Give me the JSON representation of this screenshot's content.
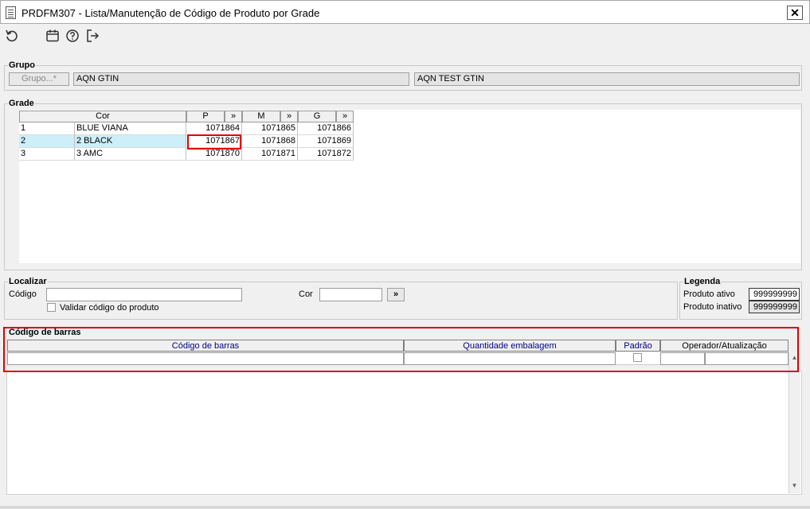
{
  "window": {
    "title": "PRDFM307 - Lista/Manutenção de Código de Produto por Grade",
    "close_label": "✕"
  },
  "toolbar": {
    "icons": [
      "refresh-icon",
      "calendar-icon",
      "help-icon",
      "exit-icon"
    ]
  },
  "grupo": {
    "title": "Grupo",
    "button_label": "Grupo...*",
    "code_value": "AQN GTIN",
    "desc_value": "AQN TEST GTIN"
  },
  "grade": {
    "title": "Grade",
    "headers": {
      "cor": "Cor",
      "p": "P",
      "m": "M",
      "g": "G",
      "more": "»"
    },
    "rows": [
      {
        "num": "1",
        "cor": "BLUE VIANA",
        "p": "1071864",
        "m": "1071865",
        "g": "1071866"
      },
      {
        "num": "2",
        "cor": "2 BLACK",
        "p": "1071867",
        "m": "1071868",
        "g": "1071869"
      },
      {
        "num": "3",
        "cor": "3 AMC",
        "p": "1071870",
        "m": "1071871",
        "g": "1071872"
      }
    ]
  },
  "localizar": {
    "title": "Localizar",
    "codigo_label": "Código",
    "codigo_value": "",
    "validar_label": "Validar código do produto",
    "cor_label": "Cor",
    "cor_value": "",
    "more_label": "»"
  },
  "legenda": {
    "title": "Legenda",
    "ativo_label": "Produto ativo",
    "ativo_value": "999999999",
    "inativo_label": "Produto inativo",
    "inativo_value": "999999999"
  },
  "barcodes": {
    "title": "Código de barras",
    "headers": {
      "codigo": "Código de barras",
      "quantidade": "Quantidade embalagem",
      "padrao": "Padrão",
      "operador": "Operador/Atualização"
    }
  },
  "colors": {
    "selection": "#cdeff9",
    "highlight_border": "#e00000",
    "header_text": "#000080"
  }
}
